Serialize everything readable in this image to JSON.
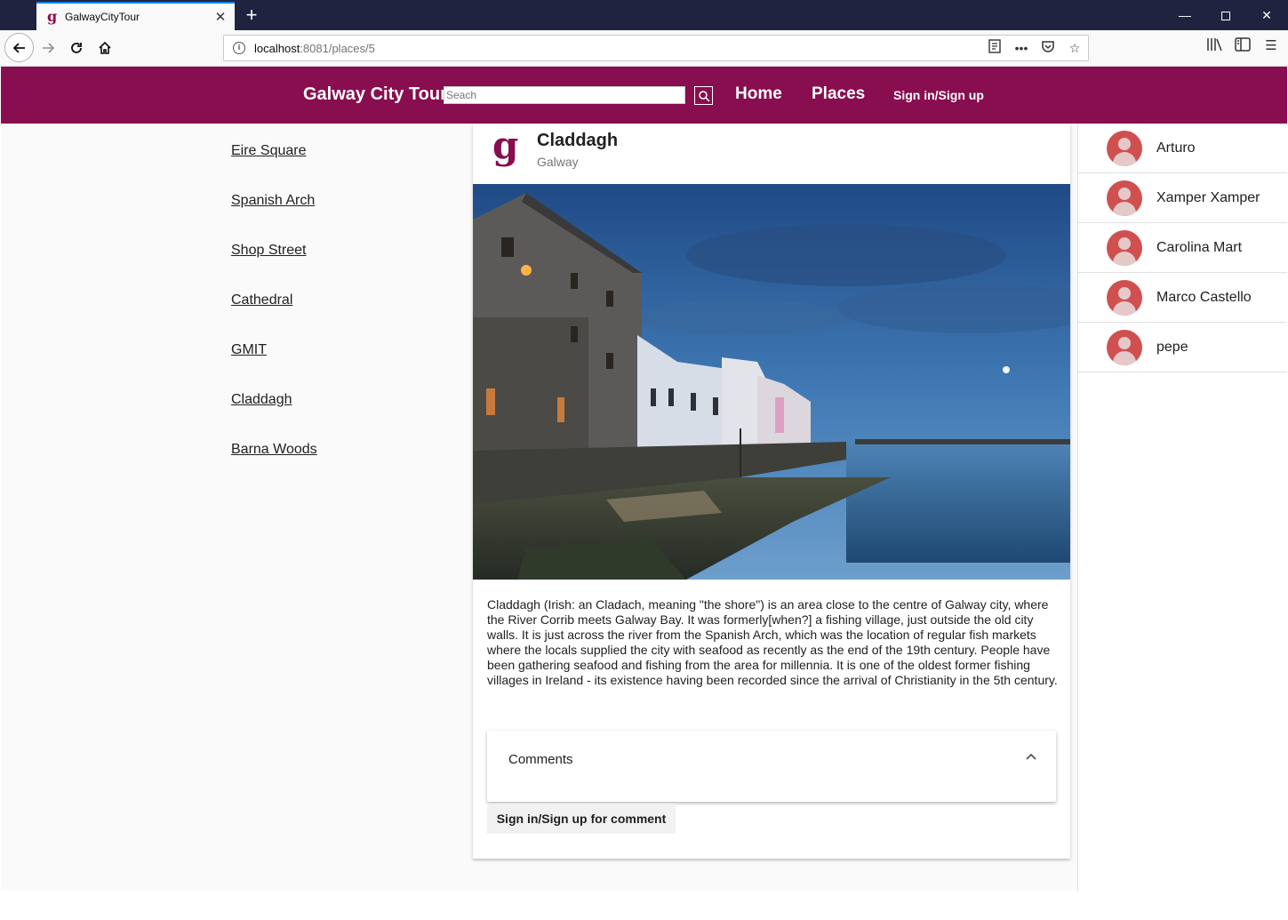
{
  "browser": {
    "tab_title": "GalwayCityTour",
    "tab_favicon": "g",
    "new_tab": "+",
    "url_host": "localhost",
    "url_rest": ":8081/places/5"
  },
  "app": {
    "brand": "Galway City Tour",
    "search_placeholder": "Seach",
    "nav": {
      "home": "Home",
      "places": "Places",
      "signin": "Sign in/Sign up"
    },
    "accent_color": "#880e4f"
  },
  "places": [
    "Eire Square",
    "Spanish Arch",
    "Shop Street",
    "Cathedral",
    "GMIT",
    "Claddagh",
    "Barna Woods"
  ],
  "place": {
    "avatar_letter": "g",
    "title": "Claddagh",
    "subtitle": "Galway",
    "description": "Claddagh (Irish: an Cladach, meaning \"the shore\") is an area close to the centre of Galway city, where the River Corrib meets Galway Bay. It was formerly[when?] a fishing village, just outside the old city walls. It is just across the river from the Spanish Arch, which was the location of regular fish markets where the locals supplied the city with seafood as recently as the end of the 19th century. People have been gathering seafood and fishing from the area for millennia. It is one of the oldest former fishing villages in Ireland - its existence having been recorded since the arrival of Christianity in the 5th century."
  },
  "comments": {
    "title": "Comments",
    "signin_button": "Sign in/Sign up for comment"
  },
  "users": [
    "Arturo",
    "Xamper Xamper",
    "Carolina Mart",
    "Marco Castello",
    "pepe"
  ]
}
